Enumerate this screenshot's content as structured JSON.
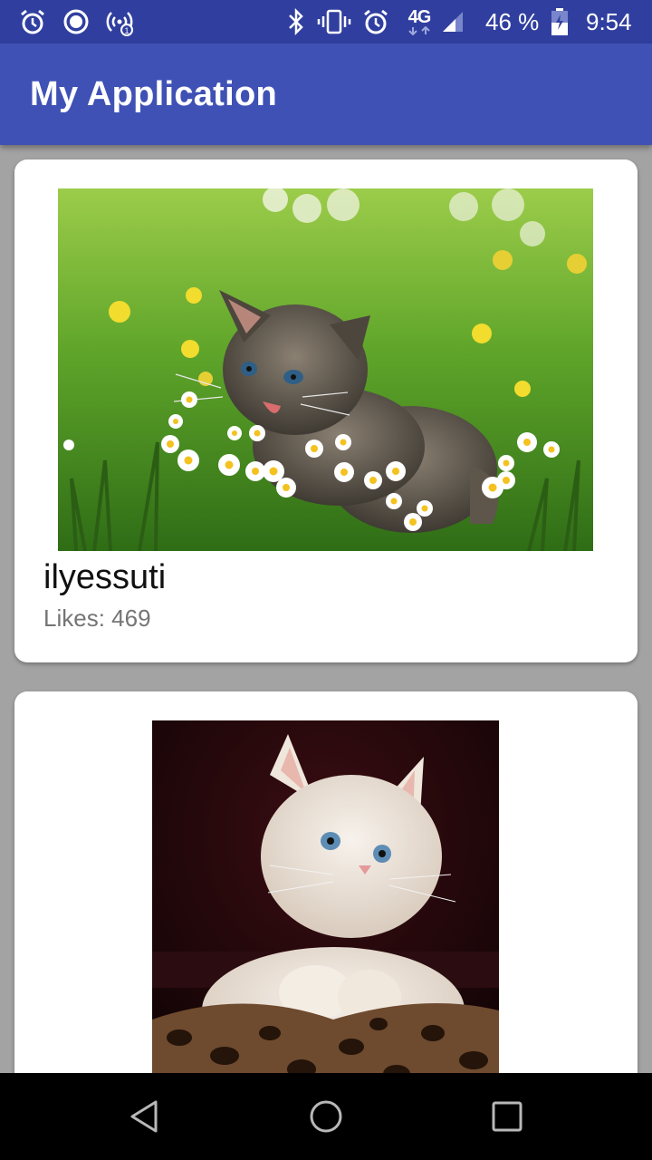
{
  "status_bar": {
    "icons": [
      "alarm-icon",
      "record-icon",
      "hotspot-icon",
      "bluetooth-icon",
      "vibrate-icon",
      "alarm-icon",
      "network-4g-icon",
      "signal-icon",
      "battery-icon"
    ],
    "network": "4G",
    "battery": "46 %",
    "time": "9:54"
  },
  "app_bar": {
    "title": "My Application"
  },
  "posts": [
    {
      "username": "ilyessuti",
      "likes": "Likes: 469",
      "image": "kitten-in-daisies"
    },
    {
      "image": "white-kitten-on-blanket"
    }
  ],
  "nav_bar": {
    "icons": [
      "back-icon",
      "home-icon",
      "recents-icon"
    ]
  },
  "colors": {
    "primary": "#3f51b5",
    "primary_dark": "#303f9f",
    "background": "#a3a3a3",
    "card": "#ffffff"
  }
}
